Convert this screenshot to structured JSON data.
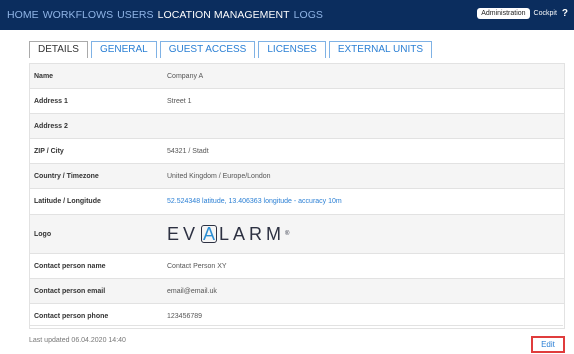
{
  "topbar": {
    "nav": [
      {
        "label": "HOME",
        "active": false
      },
      {
        "label": "WORKFLOWS",
        "active": false
      },
      {
        "label": "USERS",
        "active": false
      },
      {
        "label": "LOCATION MANAGEMENT",
        "active": true
      },
      {
        "label": "LOGS",
        "active": false
      }
    ],
    "admin_badge": "Administration",
    "cockpit_label": "Cockpit",
    "help_icon": "?"
  },
  "tabs": [
    {
      "label": "DETAILS",
      "active": true
    },
    {
      "label": "GENERAL",
      "active": false
    },
    {
      "label": "GUEST ACCESS",
      "active": false
    },
    {
      "label": "LICENSES",
      "active": false
    },
    {
      "label": "EXTERNAL UNITS",
      "active": false
    }
  ],
  "details": [
    {
      "label": "Name",
      "value": "Company A"
    },
    {
      "label": "Address 1",
      "value": "Street 1"
    },
    {
      "label": "Address 2",
      "value": ""
    },
    {
      "label": "ZIP / City",
      "value": "54321 / Stadt"
    },
    {
      "label": "Country / Timezone",
      "value": "United Kingdom / Europe/London"
    },
    {
      "label": "Latitude / Longitude",
      "value": "52.524348 latitude, 13.406363 longitude - accuracy 10m"
    },
    {
      "label": "Logo",
      "value": "EVALARM"
    },
    {
      "label": "Contact person name",
      "value": "Contact Person XY"
    },
    {
      "label": "Contact person email",
      "value": "email@email.uk"
    },
    {
      "label": "Contact person phone",
      "value": "123456789"
    }
  ],
  "logo": {
    "left": "EV",
    "boxed": "A",
    "right": "LARM",
    "mark": "®"
  },
  "footer": {
    "last_updated": "Last updated 06.04.2020 14:40",
    "edit_label": "Edit"
  },
  "colors": {
    "topbar": "#0b2d5e",
    "accent": "#2a7fd4",
    "highlight": "#e03c3c"
  }
}
